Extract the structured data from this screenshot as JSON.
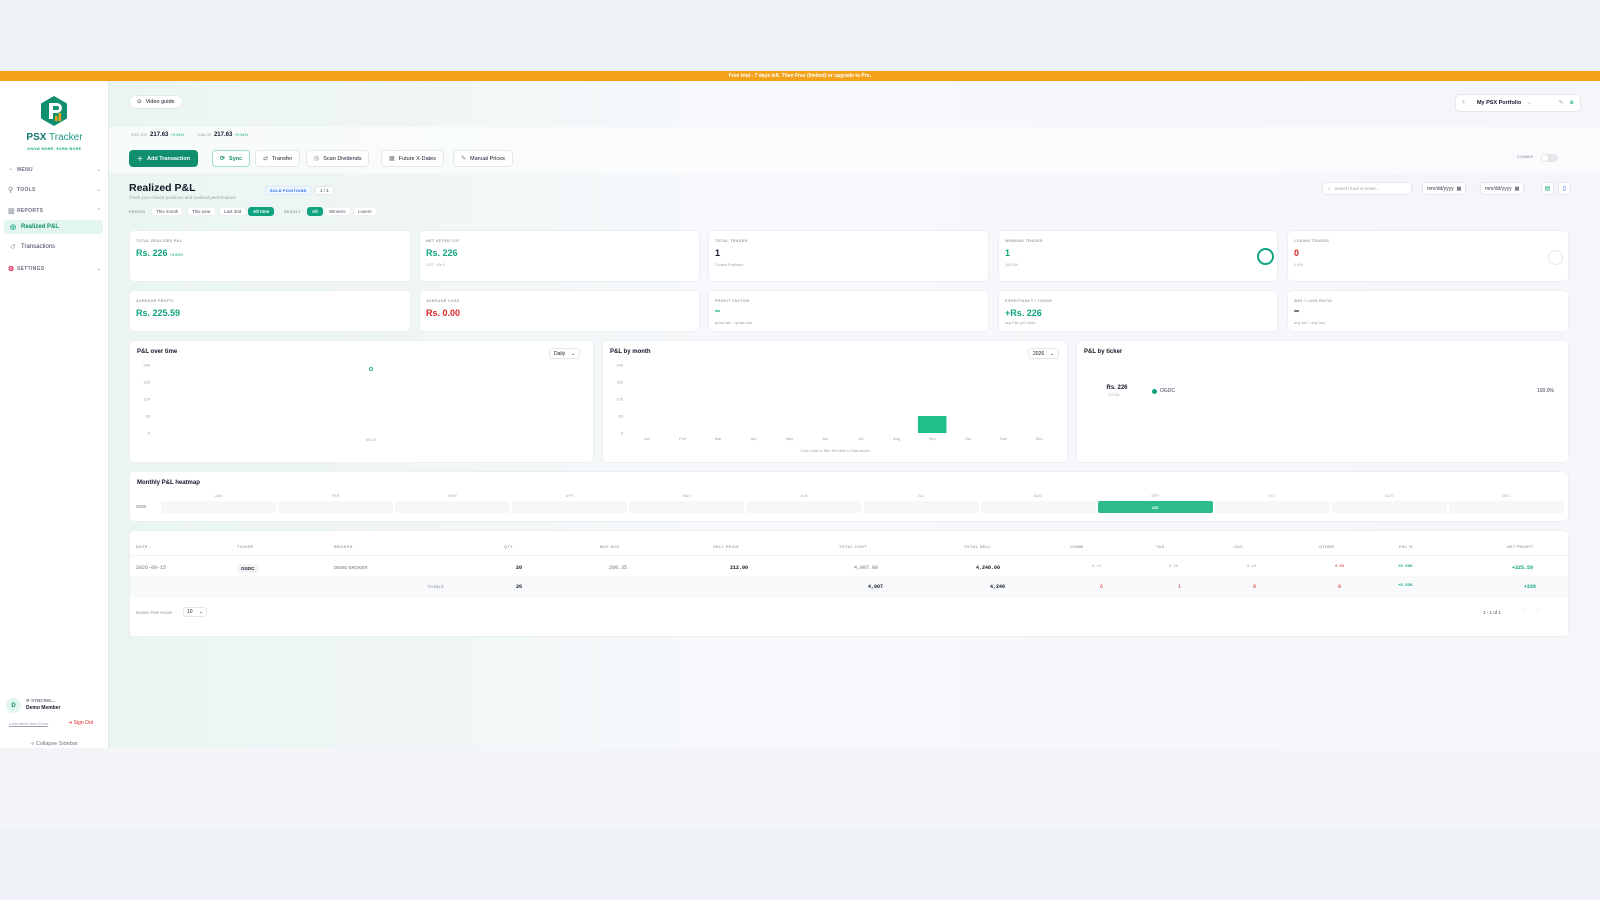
{
  "banner": {
    "text": "Free trial - 7 days left. Then Free (limited) or upgrade to Pro."
  },
  "sidebar": {
    "brand_a": "PSX",
    "brand_b": " Tracker",
    "tagline": "KNOW MORE. EARN MORE",
    "sections": {
      "menu": "MENU",
      "tools": "TOOLS",
      "reports": "REPORTS",
      "settings": "SETTINGS"
    },
    "items": {
      "realized": "Realized P&L",
      "transactions": "Transactions"
    },
    "user": {
      "initial": "D",
      "status": "⟳ SYNCING...",
      "name": "Demo Member",
      "load_link": "Load latest from Drive",
      "sign_out": "Sign Out"
    },
    "collapse": "Collapse Sidebar"
  },
  "topbar": {
    "video_guide": "Video guide",
    "portfolio": "My PSX Portfolio"
  },
  "indices": [
    {
      "name": "KSE-100",
      "value": "217.63",
      "change": "+0.34%"
    },
    {
      "name": "KMI-30",
      "value": "217.63",
      "change": "+0.34%"
    }
  ],
  "toolbar": {
    "add": "Add Transaction",
    "sync": "Sync",
    "transfer": "Transfer",
    "scan": "Scan Dividends",
    "xdates": "Future X-Dates",
    "manual": "Manual Prices",
    "combo": "COMBO"
  },
  "page": {
    "title": "Realized P&L",
    "subtitle": "Track your closed positions and realized performance",
    "badge": "SOLD POSITIONS",
    "count": "1 / 1",
    "period_label": "PERIOD",
    "periods": [
      "This month",
      "This year",
      "Last 30d",
      "All time"
    ],
    "result_label": "RESULT",
    "results": [
      "All",
      "Winners",
      "Losers"
    ],
    "search_placeholder": "Search fund or ticker...",
    "date_from": "mm/dd/yyyy",
    "date_to": "mm/dd/yyyy",
    "date_sep": "-"
  },
  "cards": {
    "total_realized": {
      "label": "TOTAL REALIZED P&L",
      "value": "Rs. 226",
      "pct": "+5.63%"
    },
    "net_after_cgt": {
      "label": "NET AFTER CGT",
      "value": "Rs. 226",
      "note": "CGT ~Rs 0"
    },
    "total_trades": {
      "label": "TOTAL TRADES",
      "value": "1",
      "note": "Closed Positions"
    },
    "winning_trades": {
      "label": "WINNING TRADES",
      "value": "1",
      "note": "100.0%",
      "ratio": 1.0
    },
    "losing_trades": {
      "label": "LOSING TRADES",
      "value": "0",
      "note": "0.0%",
      "ratio": 0.0
    },
    "avg_profit": {
      "label": "AVERAGE PROFIT",
      "value": "Rs. 225.59"
    },
    "avg_loss": {
      "label": "AVERAGE LOSS",
      "value": "Rs. 0.00"
    },
    "profit_factor": {
      "label": "PROFIT FACTOR",
      "value": "∞",
      "note": "gross win ÷ gross loss"
    },
    "expectancy": {
      "label": "EXPECTANCY / TRADE",
      "value": "+Rs. 226",
      "note": "avg P&L per trade"
    },
    "win_loss_ratio": {
      "label": "WIN / LOSS RATIO",
      "value": "∞",
      "note": "avg win ÷ avg loss"
    }
  },
  "panels": {
    "over_time": {
      "title": "P&L over time",
      "select": "Daily"
    },
    "by_month": {
      "title": "P&L by month",
      "select": "2026",
      "hint": "Click a bar to filter the table to that month"
    },
    "by_ticker": {
      "title": "P&L by ticker",
      "center_value": "Rs. 226",
      "center_label": "TOTAL",
      "legend": "OGDC",
      "legend_pct": "100.0%"
    },
    "heatmap": {
      "title": "Monthly P&L heatmap",
      "year": "2026",
      "months": [
        "JAN",
        "FEB",
        "MAR",
        "APR",
        "MAY",
        "JUN",
        "JUL",
        "AUG",
        "SEP",
        "OCT",
        "NOV",
        "DEC"
      ],
      "hot_index": 8,
      "hot_value": "226"
    }
  },
  "chart_data": [
    {
      "type": "scatter",
      "title": "P&L over time",
      "ylim": [
        0,
        240
      ],
      "yticks": [
        "240",
        "180",
        "120",
        "60",
        "0"
      ],
      "x": [
        "09-15"
      ],
      "y": [
        226
      ]
    },
    {
      "type": "bar",
      "title": "P&L by month",
      "ylim": [
        0,
        240
      ],
      "yticks": [
        "240",
        "180",
        "120",
        "60",
        "0"
      ],
      "categories": [
        "Jan",
        "Feb",
        "Mar",
        "Apr",
        "May",
        "Jun",
        "Jul",
        "Aug",
        "Sep",
        "Oct",
        "Nov",
        "Dec"
      ],
      "values": [
        0,
        0,
        0,
        0,
        0,
        0,
        0,
        0,
        60,
        0,
        0,
        0
      ]
    },
    {
      "type": "pie",
      "title": "P&L by ticker",
      "categories": [
        "OGDC"
      ],
      "values": [
        100.0
      ]
    }
  ],
  "table": {
    "headers": [
      "DATE ↓",
      "TICKER",
      "BROKER",
      "QTY",
      "BUY AVG",
      "SELL PRICE",
      "TOTAL COST",
      "TOTAL SELL",
      "COMM",
      "TAX",
      "CDC",
      "OTHER",
      "P&L %",
      "NET PROFIT"
    ],
    "row": {
      "date": "2026-09-15",
      "ticker": "OGDC",
      "broker": "DEMO BROKER",
      "qty": "20",
      "buy_avg": "200.35",
      "sell_price": "212.00",
      "total_cost": "4,007.00",
      "total_sell": "4,240.00",
      "comm": "5.41",
      "tax": "0.35",
      "cdc": "0.10",
      "other": "0.00",
      "pl_pct": "+5.63%",
      "net_profit": "+225.59"
    },
    "totals": {
      "label": "TOTALS",
      "qty": "20",
      "total_cost": "4,007",
      "total_sell": "4,240",
      "comm": "6",
      "tax": "1",
      "cdc": "0",
      "other": "0",
      "pl_pct": "+5.63%",
      "net_profit": "+226"
    },
    "rows_per_page_label": "ROWS PER PAGE:",
    "rows_per_page": "10",
    "pager": "1 - 1 of 1"
  },
  "colors": {
    "accent": "#10a37f",
    "banner": "#f4a21a",
    "loss": "#dc2626"
  }
}
